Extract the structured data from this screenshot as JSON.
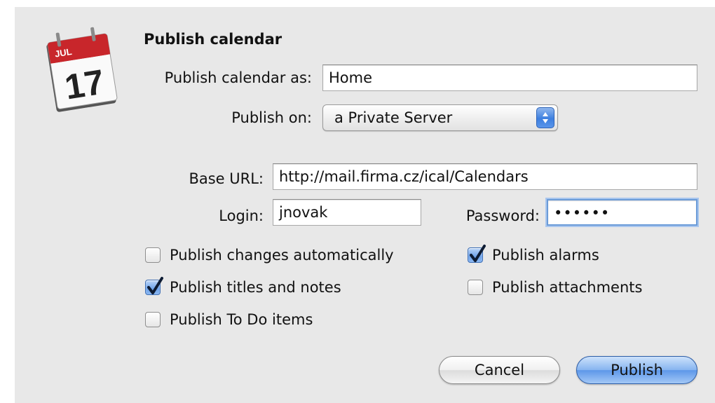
{
  "dialog": {
    "title": "Publish calendar",
    "icon": {
      "name": "calendar-icon",
      "month": "JUL",
      "day": "17"
    },
    "publish_as": {
      "label": "Publish calendar as:",
      "value": "Home"
    },
    "publish_on": {
      "label": "Publish on:",
      "value": "a Private Server"
    },
    "base_url": {
      "label": "Base URL:",
      "value": "http://mail.firma.cz/ical/Calendars"
    },
    "login": {
      "label": "Login:",
      "value": "jnovak"
    },
    "password": {
      "label": "Password:",
      "value": "••••••"
    },
    "options": {
      "changes_auto": {
        "label": "Publish changes automatically",
        "checked": false
      },
      "titles_notes": {
        "label": "Publish titles and notes",
        "checked": true
      },
      "todo_items": {
        "label": "Publish To Do items",
        "checked": false
      },
      "alarms": {
        "label": "Publish alarms",
        "checked": true
      },
      "attachments": {
        "label": "Publish attachments",
        "checked": false
      }
    },
    "buttons": {
      "cancel": "Cancel",
      "publish": "Publish"
    }
  }
}
